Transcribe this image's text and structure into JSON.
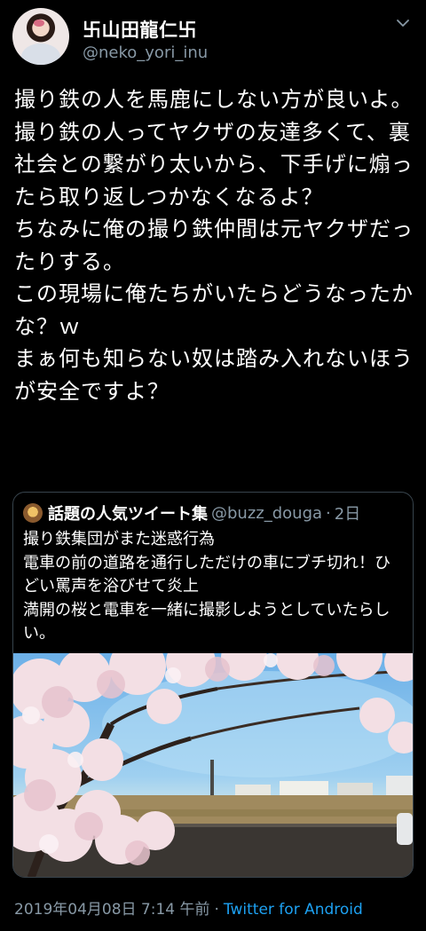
{
  "tweet": {
    "author": {
      "display_name": "卐山田龍仁卐",
      "handle": "@neko_yori_inu"
    },
    "text": "撮り鉄の人を馬鹿にしない方が良いよ。\n撮り鉄の人ってヤクザの友達多くて、裏社会との繋がり太いから、下手げに煽ったら取り返しつかなくなるよ？\nちなみに俺の撮り鉄仲間は元ヤクザだったりする。\nこの現場に俺たちがいたらどうなったかな？ｗ\nまぁ何も知らない奴は踏み入れないほうが安全ですよ？",
    "timestamp": "2019年04月08日 7:14 午前",
    "separator": "·",
    "source": "Twitter for Android"
  },
  "quoted": {
    "name": "話題の人気ツイート集",
    "handle": "@buzz_douga",
    "separator": "·",
    "age": "2日",
    "text": "撮り鉄集団がまた迷惑行為\n電車の前の道路を通行しただけの車にブチ切れ！ひどい罵声を浴びせて炎上\n満開の桜と電車を一緒に撮影しようとしていたらしい。",
    "media": "photo of cherry blossoms beside a railway under blue sky"
  },
  "icons": {
    "menu": "chevron-down-icon",
    "avatar": "user-avatar",
    "quoted_avatar": "quoted-user-avatar"
  },
  "colors": {
    "background": "#000000",
    "text": "#ffffff",
    "muted": "#8899a6",
    "link": "#1da1f2",
    "border": "#38444d"
  }
}
